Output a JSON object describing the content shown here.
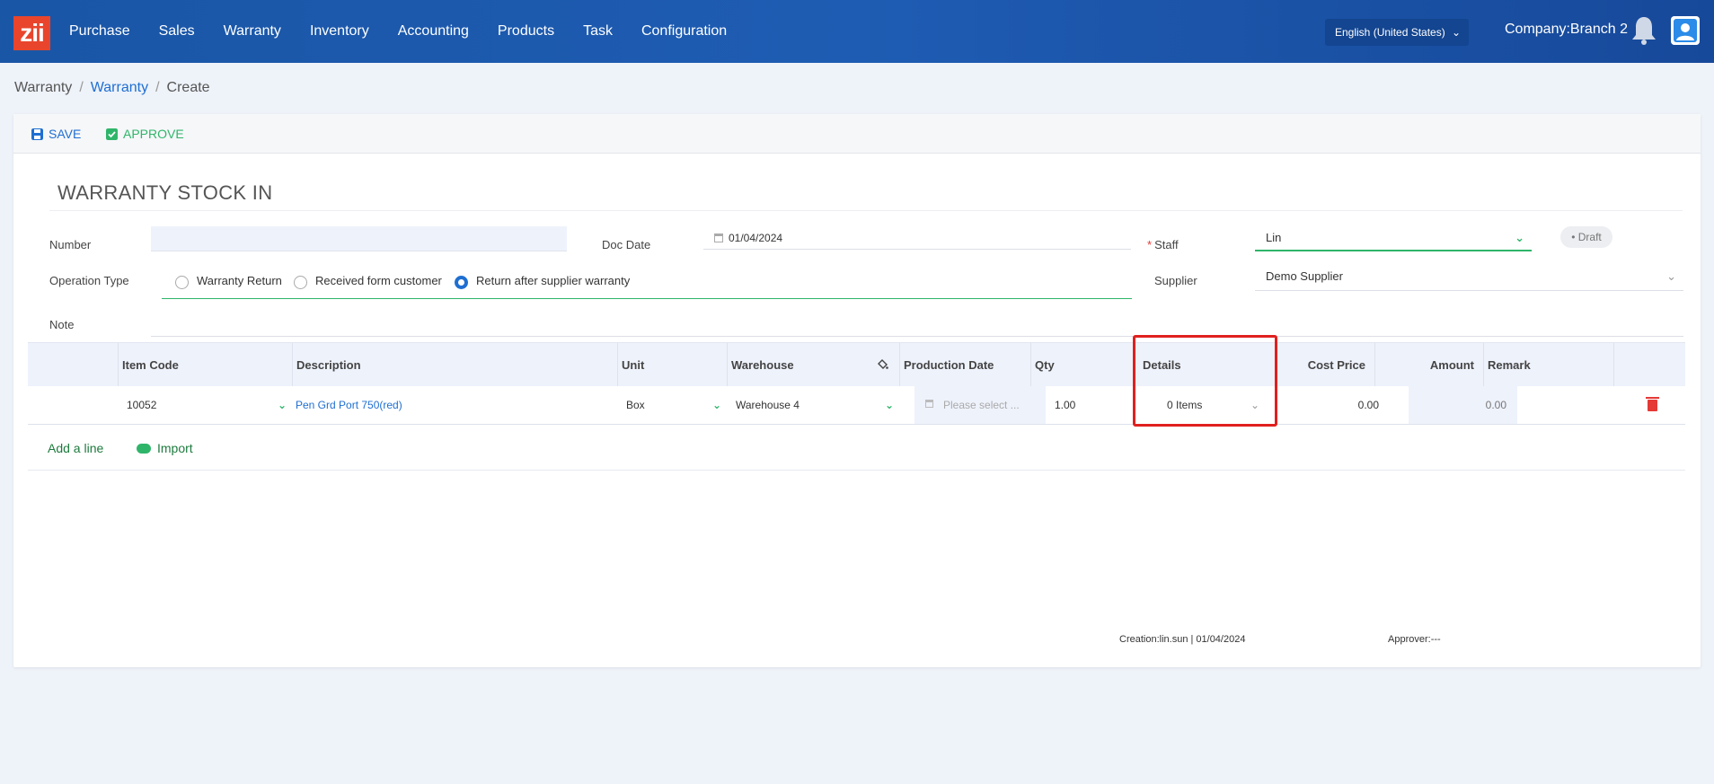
{
  "app": {
    "logo_text": "zii",
    "nav": [
      "Purchase",
      "Sales",
      "Warranty",
      "Inventory",
      "Accounting",
      "Products",
      "Task",
      "Configuration"
    ],
    "language": "English (United States)",
    "company": "Company:Branch 2"
  },
  "breadcrumb": {
    "root": "Warranty",
    "link": "Warranty",
    "current": "Create",
    "separator": "/"
  },
  "toolbar": {
    "save_label": "SAVE",
    "approve_label": "APPROVE"
  },
  "form": {
    "title": "WARRANTY STOCK IN",
    "number_label": "Number",
    "number_value": "",
    "doc_date_label": "Doc Date",
    "doc_date_value": "01/04/2024",
    "staff_label": "Staff",
    "staff_value": "Lin",
    "status": "Draft",
    "operation_type_label": "Operation Type",
    "operation_types": [
      "Warranty Return",
      "Received form customer",
      "Return after supplier warranty"
    ],
    "operation_type_selected": "Return after supplier warranty",
    "supplier_label": "Supplier",
    "supplier_value": "Demo Supplier",
    "note_label": "Note",
    "note_value": ""
  },
  "table": {
    "columns": [
      "Item Code",
      "Description",
      "Unit",
      "Warehouse",
      "Production Date",
      "Qty",
      "Details",
      "Cost Price",
      "Amount",
      "Remark"
    ],
    "rows": [
      {
        "item_code": "10052",
        "description": "Pen Grd Port 750(red)",
        "unit": "Box",
        "warehouse": "Warehouse 4",
        "production_date_placeholder": "Please select ...",
        "qty": "1.00",
        "details": "0 Items",
        "cost_price": "0.00",
        "amount": "0.00",
        "remark": ""
      }
    ],
    "add_line_label": "Add a line",
    "import_label": "Import"
  },
  "footer": {
    "creation": "Creation:lin.sun | 01/04/2024",
    "approver": "Approver:---"
  },
  "colors": {
    "topbar": "#1e5cb3",
    "accent_blue": "#1f6fd1",
    "accent_green": "#2fb56a",
    "highlight": "#e0201f"
  }
}
